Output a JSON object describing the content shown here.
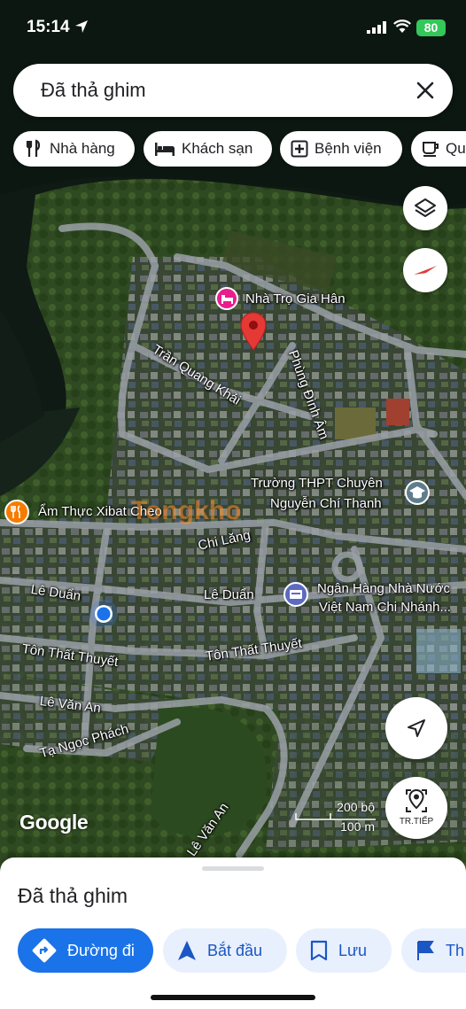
{
  "status_bar": {
    "time": "15:14",
    "battery": "80"
  },
  "search": {
    "text": "Đã thả ghim"
  },
  "chips": [
    {
      "label": "Nhà hàng",
      "icon": "restaurant-icon"
    },
    {
      "label": "Khách sạn",
      "icon": "hotel-icon"
    },
    {
      "label": "Bệnh viện",
      "icon": "hospital-icon"
    },
    {
      "label": "Qu",
      "icon": "coffee-icon"
    }
  ],
  "map": {
    "places": {
      "guesthouse": "Nhà Trọ Gia Hân",
      "school_line1": "Trường THPT Chuyên",
      "school_line2": "Nguyễn Chí Thanh",
      "restaurant": "Ẩm Thực Xibat Cheo",
      "bank_line1": "Ngân Hàng Nhà Nước",
      "bank_line2": "Việt Nam Chi Nhánh..."
    },
    "streets": {
      "tran_quang_khai": "Trần Quang Khải",
      "phung_dinh_am": "Phùng Đình Âm",
      "chi_lang": "Chi Lăng",
      "le_duan_1": "Lê Duẩn",
      "le_duan_2": "Lê Duẩn",
      "ton_that_thuyet_1": "Tôn Thất Thuyết",
      "ton_that_thuyet_2": "Tôn Thất Thuyết",
      "le_van_an_1": "Lê Văn An",
      "le_van_an_2": "Lê Văn An",
      "ta_ngoc_phach": "Tạ Ngọc Phách"
    },
    "watermark": "Tongkho",
    "google": "Google",
    "scale_imperial": "200 bộ",
    "scale_metric": "100 m",
    "street_view_label": "TR.TIẾP"
  },
  "sheet": {
    "title": "Đã thả ghim",
    "actions": [
      {
        "label": "Đường đi",
        "style": "primary",
        "icon": "directions-icon"
      },
      {
        "label": "Bắt đầu",
        "style": "secondary",
        "icon": "navigation-arrow-icon"
      },
      {
        "label": "Lưu",
        "style": "secondary",
        "icon": "bookmark-icon"
      },
      {
        "label": "Th",
        "style": "secondary",
        "icon": "flag-icon"
      }
    ]
  },
  "colors": {
    "accent": "#1a73e8",
    "pin": "#e53935",
    "guesthouse": "#e91e8c",
    "bank": "#5c6bc0",
    "restaurant": "#f57c00"
  }
}
